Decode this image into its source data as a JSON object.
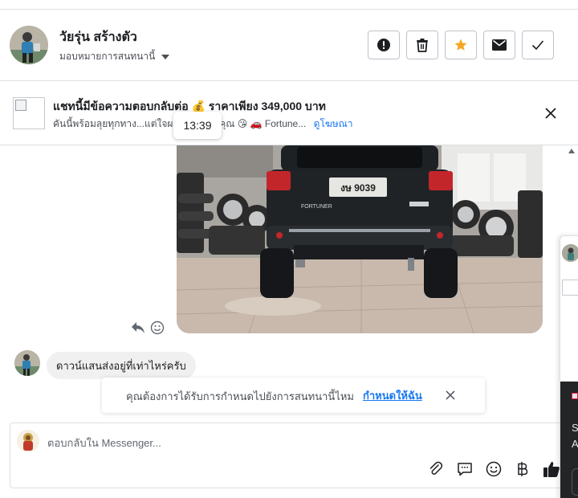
{
  "header": {
    "contact_name": "วัยรุ่น สร้างตัว",
    "assign_label": "มอบหมายการสนทนานี้",
    "actions": [
      {
        "name": "report-button",
        "icon": "exclamation-circle-icon"
      },
      {
        "name": "delete-button",
        "icon": "trash-icon"
      },
      {
        "name": "star-button",
        "icon": "star-icon",
        "color": "#f5a623"
      },
      {
        "name": "mark-unread-button",
        "icon": "envelope-icon"
      },
      {
        "name": "done-button",
        "icon": "checkmark-icon"
      }
    ]
  },
  "ad_banner": {
    "title": "แชทนี้มีข้อความตอบกลับต่อ 💰 ราคาเพียง 349,000 บาท",
    "subtitle": "คันนี้พร้อมลุยทุกทาง...แต่ใจผม           ครั้งที่เจอคุณ 😘 🚗 Fortune...",
    "view_ad_link": "ดูโฆษณา",
    "timestamp_tooltip": "13:39"
  },
  "messages": [
    {
      "type": "image",
      "alt": "car photo",
      "from": "page",
      "plate_text": "งษ 9039"
    },
    {
      "type": "text",
      "from": "customer",
      "text": "ดาวน์แสนส่งอยู่ที่เท่าไหร่ครับ"
    }
  ],
  "suggestion_toast": {
    "text": "คุณต้องการได้รับการกำหนดไปยังการสนทนานี้ไหม",
    "action_link": "กำหนดให้ฉัน"
  },
  "composer": {
    "placeholder": "ตอบกลับใน Messenger...",
    "tools": [
      "paperclip-icon",
      "saved-reply-icon",
      "emoji-icon",
      "baht-icon",
      "thumbs-up-icon"
    ]
  },
  "side_panel": {
    "dark_letters": [
      "S",
      "A"
    ]
  },
  "colors": {
    "accent": "#1877f2",
    "star": "#f5a623",
    "bubble_bg": "#f0f0f0",
    "border": "#dddfe2"
  }
}
